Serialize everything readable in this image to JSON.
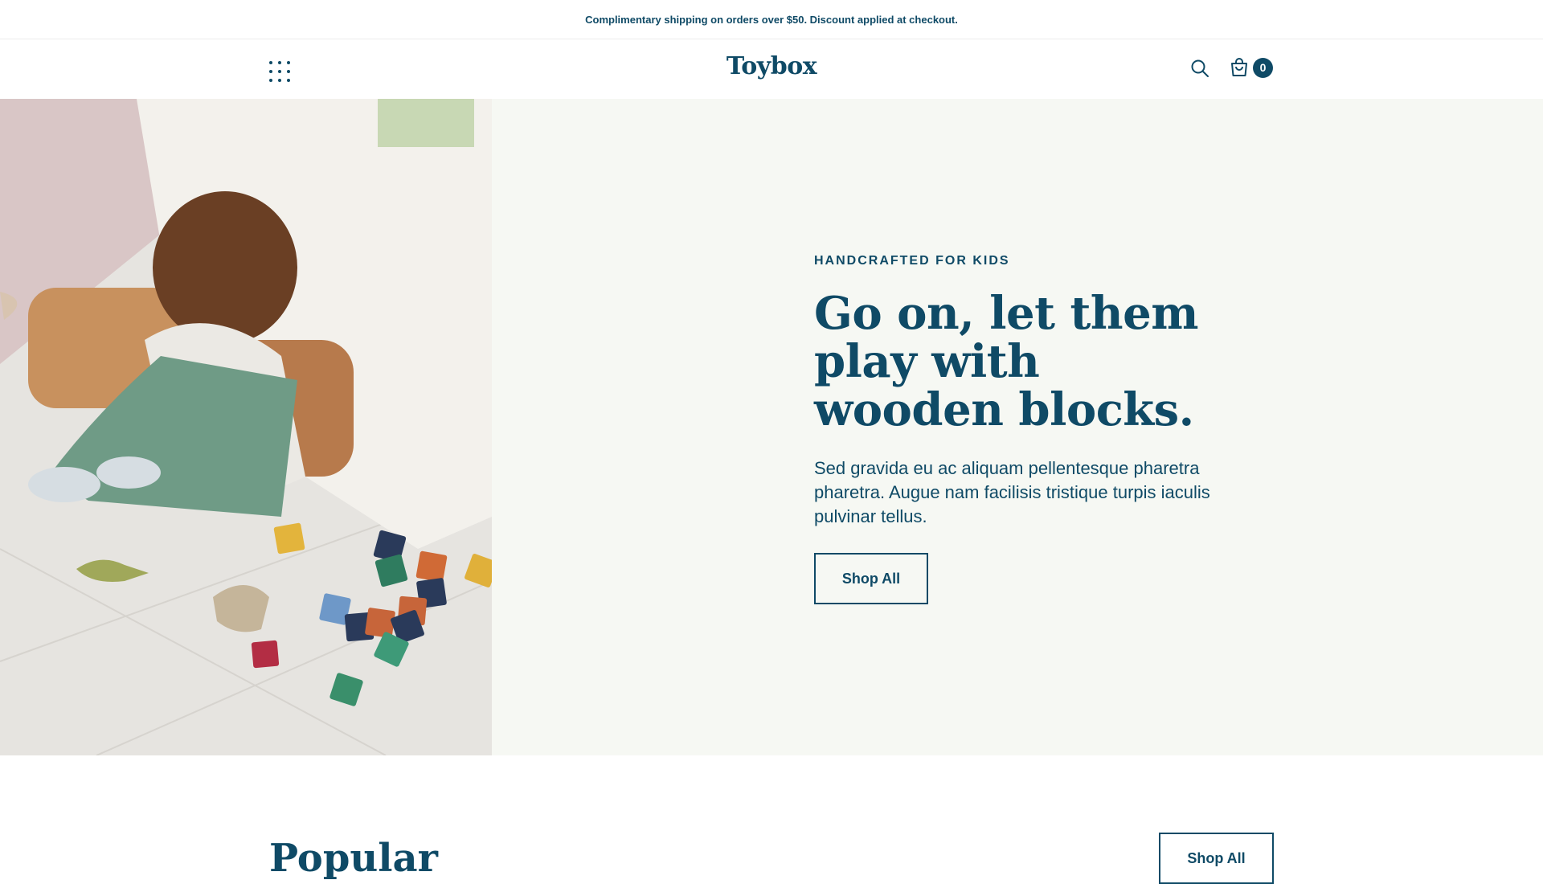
{
  "announcement": "Complimentary shipping on orders over $50. Discount applied at checkout.",
  "header": {
    "logo": "Toybox",
    "menu_icon": "dots-grid-icon",
    "search_icon": "search-icon",
    "cart_icon": "shopping-bag-icon",
    "cart_count": "0"
  },
  "hero": {
    "image_alt": "Child playing with wooden blocks on the floor",
    "eyebrow": "HANDCRAFTED FOR KIDS",
    "headline": "Go on, let them play with wooden blocks.",
    "subtext": "Sed gravida eu ac aliquam pellentesque pharetra pharetra. Augue nam facilisis tristique turpis iaculis pulvinar tellus.",
    "button_label": "Shop All"
  },
  "popular": {
    "title": "Popular",
    "button_label": "Shop All"
  },
  "colors": {
    "brand": "#0f4a66",
    "hero_bg": "#f6f8f3",
    "background": "#ffffff"
  }
}
